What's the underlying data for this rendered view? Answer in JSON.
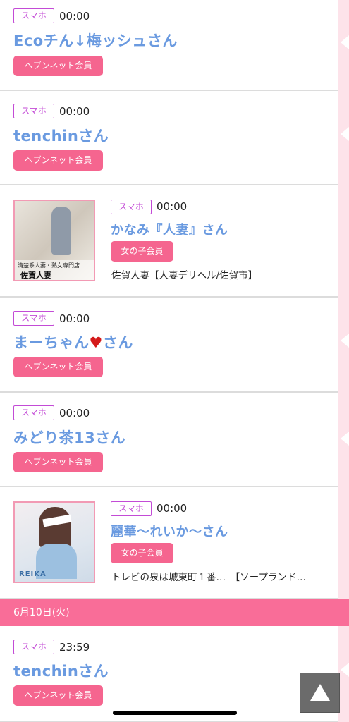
{
  "entries": [
    {
      "device": "スマホ",
      "time": "00:00",
      "name": "Ecoチん↓梅ッシュさん",
      "member": "ヘブンネット会員"
    },
    {
      "device": "スマホ",
      "time": "00:00",
      "name": "tenchinさん",
      "member": "ヘブンネット会員"
    },
    {
      "device": "スマホ",
      "time": "00:00",
      "name": "かなみ『人妻』さん",
      "member": "女の子会員",
      "shop": "佐賀人妻【人妻デリヘル/佐賀市】",
      "thumb_text1": "清楚系人妻・熟女専門店",
      "thumb_text2": "佐賀人妻"
    },
    {
      "device": "スマホ",
      "time": "00:00",
      "name_prefix": "まーちゃん",
      "name_suffix": "さん",
      "heart": "♥",
      "member": "ヘブンネット会員"
    },
    {
      "device": "スマホ",
      "time": "00:00",
      "name": "みどり茶13さん",
      "member": "ヘブンネット会員"
    },
    {
      "device": "スマホ",
      "time": "00:00",
      "name": "麗華〜れいか〜さん",
      "member": "女の子会員",
      "shop": "トレビの泉は城東町１番…　【ソープランド…",
      "thumb_text1": "REIKA"
    },
    {
      "device": "スマホ",
      "time": "23:59",
      "name": "tenchinさん",
      "member": "ヘブンネット会員"
    }
  ],
  "date_header": "6月10日(火)",
  "scroll_top_icon": "triangle-up-icon"
}
